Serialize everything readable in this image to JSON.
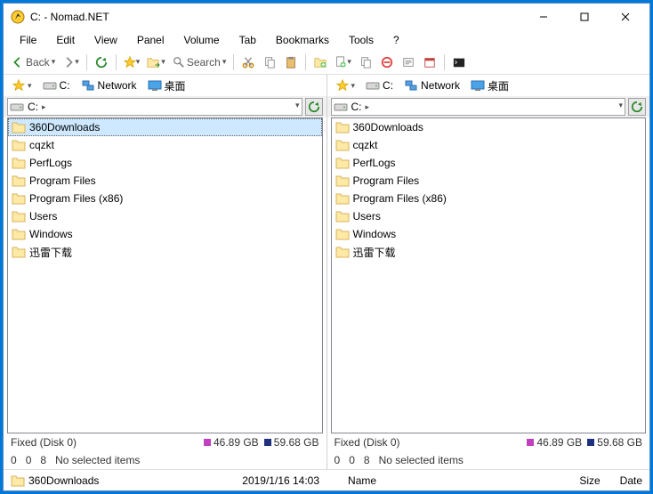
{
  "title": "C: - Nomad.NET",
  "menu": [
    "File",
    "Edit",
    "View",
    "Panel",
    "Volume",
    "Tab",
    "Bookmarks",
    "Tools",
    "?"
  ],
  "toolbar": {
    "back": "Back",
    "search": "Search"
  },
  "drivebar": {
    "c": "C:",
    "network": "Network",
    "desktop": "桌面"
  },
  "pathbar": {
    "c": "C:"
  },
  "folders": [
    "360Downloads",
    "cqzkt",
    "PerfLogs",
    "Program Files",
    "Program Files (x86)",
    "Users",
    "Windows",
    "迅雷下载"
  ],
  "status": {
    "disk": "Fixed (Disk 0)",
    "free": "46.89 GB",
    "total": "59.68 GB",
    "freeColor": "#c040c0",
    "totalColor": "#203080"
  },
  "sel": {
    "a": "0",
    "b": "0",
    "c": "8",
    "text": "No selected items"
  },
  "bottom": {
    "name": "360Downloads",
    "date": "2019/1/16 14:03",
    "rname": "Name",
    "size": "Size",
    "rdate": "Date"
  }
}
